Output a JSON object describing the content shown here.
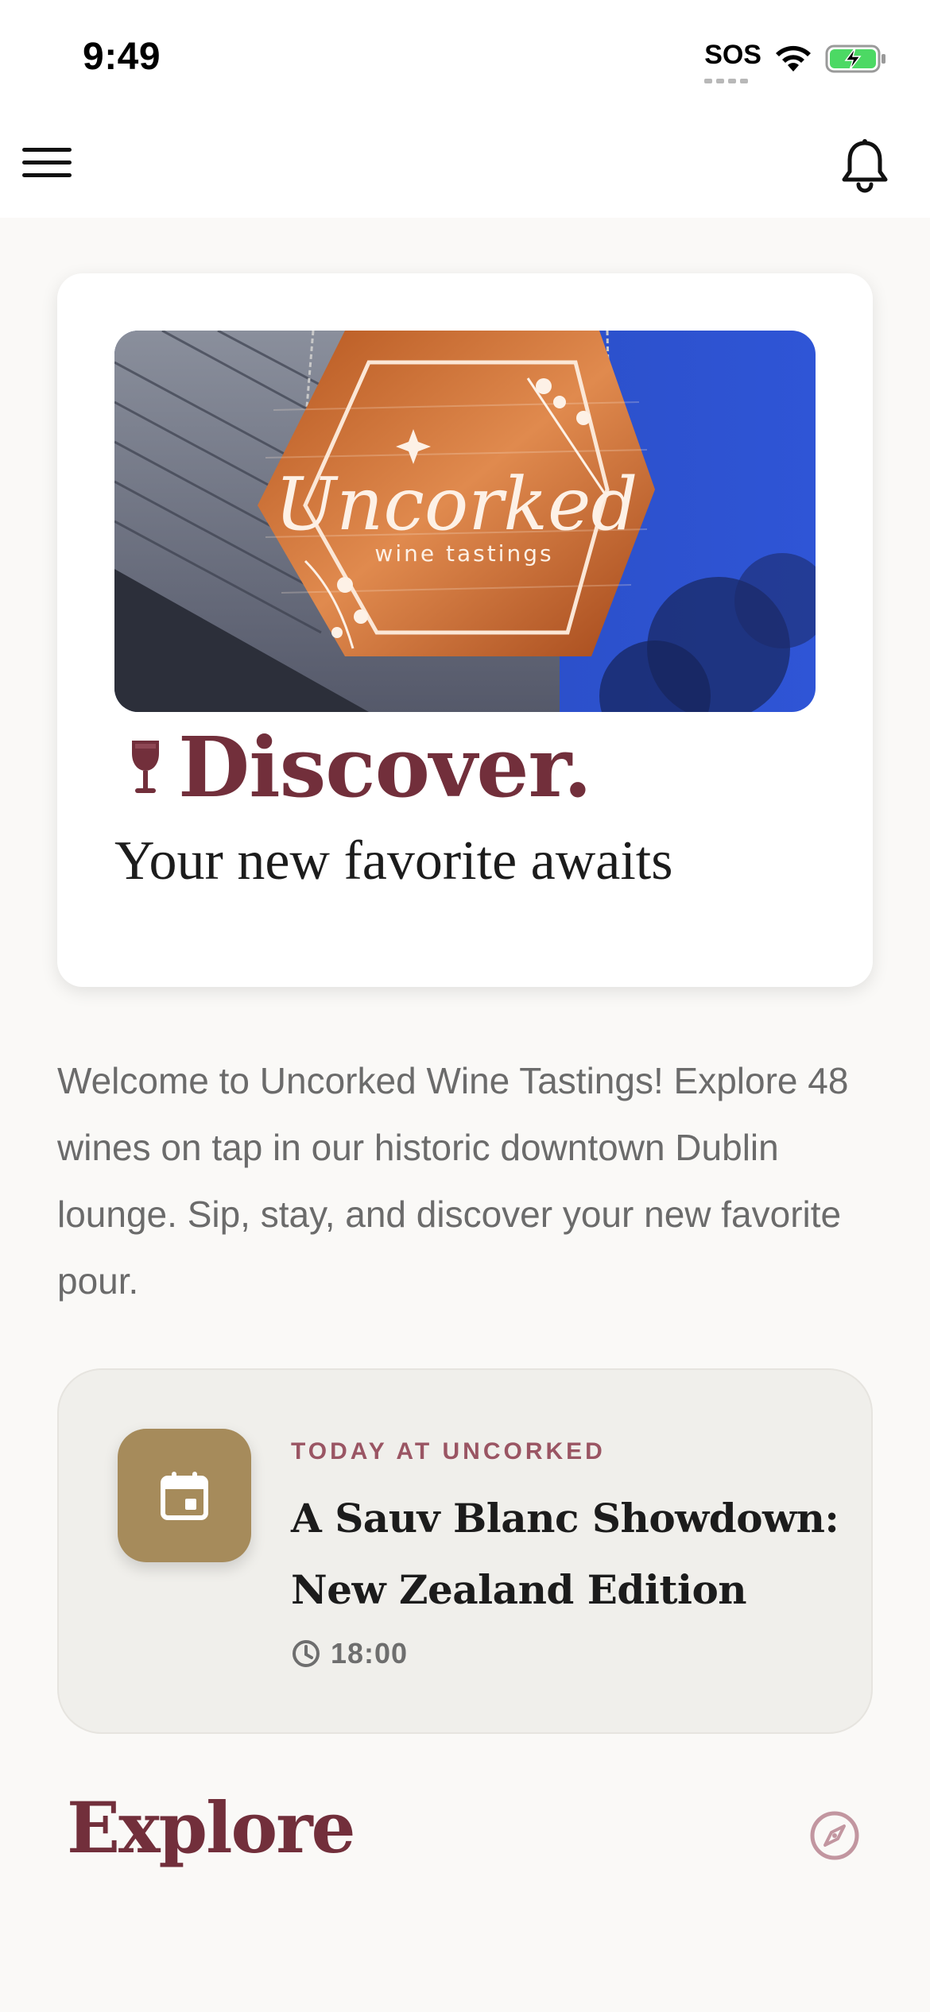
{
  "status_bar": {
    "time": "9:49",
    "sos": "SOS"
  },
  "nav": {
    "menu_icon": "hamburger-menu-icon",
    "notification_icon": "bell-icon"
  },
  "hero": {
    "image_alt_sign_text": "Uncorked",
    "image_alt_sign_subtext": "wine tastings",
    "title": "Discover.",
    "title_icon": "wine-glass-icon",
    "subtitle": "Your new favorite awaits"
  },
  "welcome_text": "Welcome to Uncorked Wine Tastings! Explore 48 wines on tap in our historic downtown Dublin lounge. Sip, stay, and discover your new favorite pour.",
  "event": {
    "eyebrow": "TODAY AT UNCORKED",
    "title": "A Sauv Blanc Showdown: New Zealand Edition",
    "time": "18:00",
    "icon": "calendar-icon"
  },
  "explore": {
    "title": "Explore",
    "icon": "compass-icon"
  },
  "colors": {
    "brand_wine": "#722f3b",
    "event_gold": "#a68b5b",
    "eyebrow_rose": "#9a5563",
    "background": "#faf9f7"
  }
}
